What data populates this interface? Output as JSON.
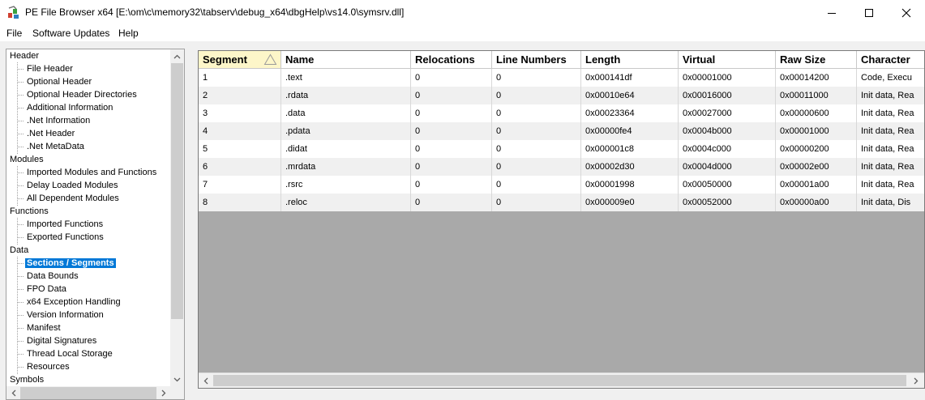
{
  "window": {
    "title": "PE File Browser x64 [E:\\om\\c\\memory32\\tabserv\\debug_x64\\dbgHelp\\vs14.0\\symsrv.dll]",
    "icon": "pe-browser-app-icon"
  },
  "menu": [
    "File",
    "Software Updates",
    "Help"
  ],
  "tree": {
    "groups": [
      {
        "label": "Header",
        "children": [
          "File Header",
          "Optional Header",
          "Optional Header Directories",
          "Additional Information",
          ".Net Information",
          ".Net Header",
          ".Net MetaData"
        ]
      },
      {
        "label": "Modules",
        "children": [
          "Imported Modules and Functions",
          "Delay Loaded Modules",
          "All Dependent Modules"
        ]
      },
      {
        "label": "Functions",
        "children": [
          "Imported Functions",
          "Exported Functions"
        ]
      },
      {
        "label": "Data",
        "children": [
          "Sections / Segments",
          "Data Bounds",
          "FPO Data",
          "x64 Exception Handling",
          "Version Information",
          "Manifest",
          "Digital Signatures",
          "Thread Local Storage",
          "Resources"
        ]
      },
      {
        "label": "Symbols",
        "children": []
      }
    ],
    "selected": "Sections / Segments"
  },
  "table": {
    "columns": [
      "Segment",
      "Name",
      "Relocations",
      "Line Numbers",
      "Length",
      "Virtual",
      "Raw Size",
      "Character"
    ],
    "sorted_column": "Segment",
    "rows": [
      [
        "1",
        ".text",
        "0",
        "0",
        "0x000141df",
        "0x00001000",
        "0x00014200",
        "Code, Execu"
      ],
      [
        "2",
        ".rdata",
        "0",
        "0",
        "0x00010e64",
        "0x00016000",
        "0x00011000",
        "Init data, Rea"
      ],
      [
        "3",
        ".data",
        "0",
        "0",
        "0x00023364",
        "0x00027000",
        "0x00000600",
        "Init data, Rea"
      ],
      [
        "4",
        ".pdata",
        "0",
        "0",
        "0x00000fe4",
        "0x0004b000",
        "0x00001000",
        "Init data, Rea"
      ],
      [
        "5",
        ".didat",
        "0",
        "0",
        "0x000001c8",
        "0x0004c000",
        "0x00000200",
        "Init data, Rea"
      ],
      [
        "6",
        ".mrdata",
        "0",
        "0",
        "0x00002d30",
        "0x0004d000",
        "0x00002e00",
        "Init data, Rea"
      ],
      [
        "7",
        ".rsrc",
        "0",
        "0",
        "0x00001998",
        "0x00050000",
        "0x00001a00",
        "Init data, Rea"
      ],
      [
        "8",
        ".reloc",
        "0",
        "0",
        "0x000009e0",
        "0x00052000",
        "0x00000a00",
        "Init data, Dis"
      ]
    ]
  },
  "colors": {
    "selection": "#0078d7",
    "sorted_header": "#fdf6c9",
    "grid_empty": "#a9a9a9"
  }
}
